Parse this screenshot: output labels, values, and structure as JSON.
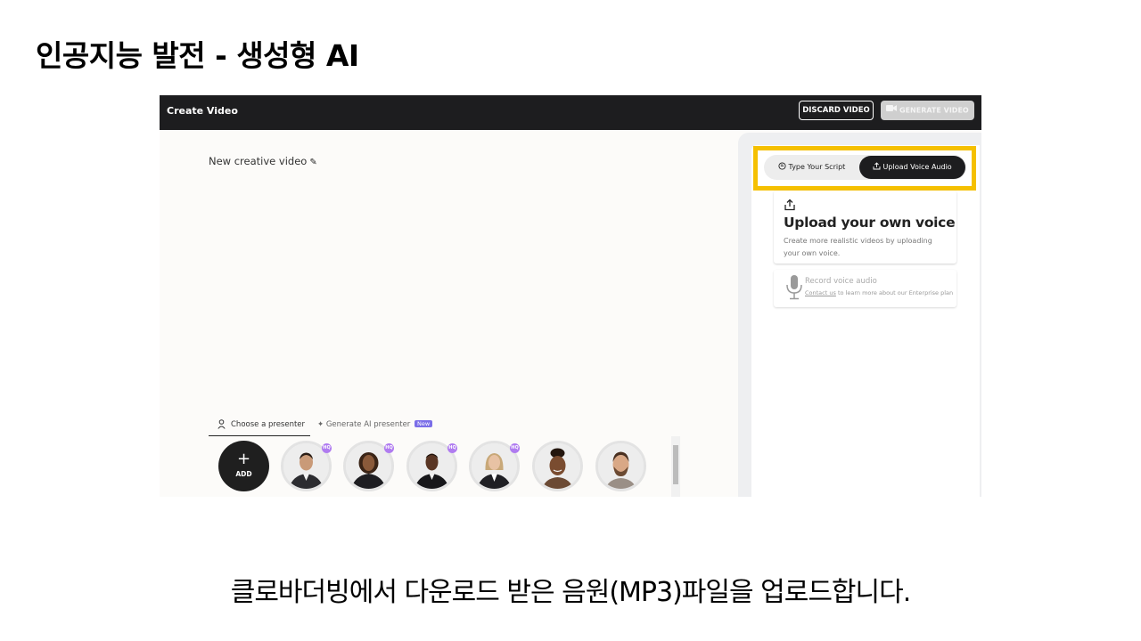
{
  "slide": {
    "title": "인공지능 발전 - 생성형 AI",
    "caption": "클로바더빙에서 다운로드 받은 음원(MP3)파일을 업로드합니다."
  },
  "header": {
    "title": "Create Video",
    "discard_label": "DISCARD VIDEO",
    "generate_label": "GENERATE VIDEO"
  },
  "editor": {
    "video_name": "New creative video"
  },
  "presenters": {
    "tab_choose": "Choose a presenter",
    "tab_generate": "Generate AI presenter",
    "new_badge": "New",
    "add_label": "ADD",
    "plus_symbol": "+",
    "hq_label": "HQ"
  },
  "script_panel": {
    "tab_type_script": "Type Your Script",
    "tab_upload_audio": "Upload Voice Audio",
    "upload_title": "Upload your own voice",
    "upload_desc": "Create more realistic videos by uploading your own voice.",
    "record_title": "Record voice audio",
    "record_link": "Contact us",
    "record_note_rest": " to learn more about our Enterprise plan"
  },
  "colors": {
    "highlight": "#f5c000",
    "topbar": "#1d1d1f",
    "hq_badge": "#b07cf0",
    "new_badge": "#7b6ee8"
  }
}
